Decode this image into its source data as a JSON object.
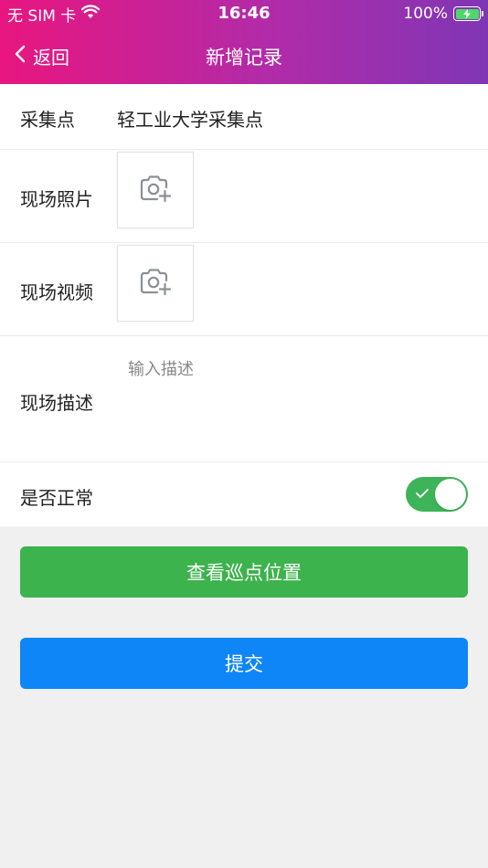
{
  "status_bar": {
    "carrier": "无 SIM 卡",
    "time": "16:46",
    "battery": "100%"
  },
  "nav": {
    "back_label": "返回",
    "title": "新增记录"
  },
  "form": {
    "collection_point": {
      "label": "采集点",
      "value": "轻工业大学采集点"
    },
    "photo": {
      "label": "现场照片"
    },
    "video": {
      "label": "现场视频"
    },
    "description": {
      "label": "现场描述",
      "placeholder": "输入描述",
      "value": ""
    },
    "normal": {
      "label": "是否正常",
      "checked": true
    }
  },
  "buttons": {
    "view_location": "查看巡点位置",
    "submit": "提交"
  },
  "colors": {
    "header_gradient_start": "#e8167f",
    "header_gradient_end": "#7f36b5",
    "toggle_on": "#3db35a",
    "green_button": "#3cb34c",
    "blue_button": "#0f86f8"
  },
  "icons": [
    "wifi-icon",
    "battery-icon",
    "chevron-left-icon",
    "camera-add-icon",
    "check-icon"
  ]
}
